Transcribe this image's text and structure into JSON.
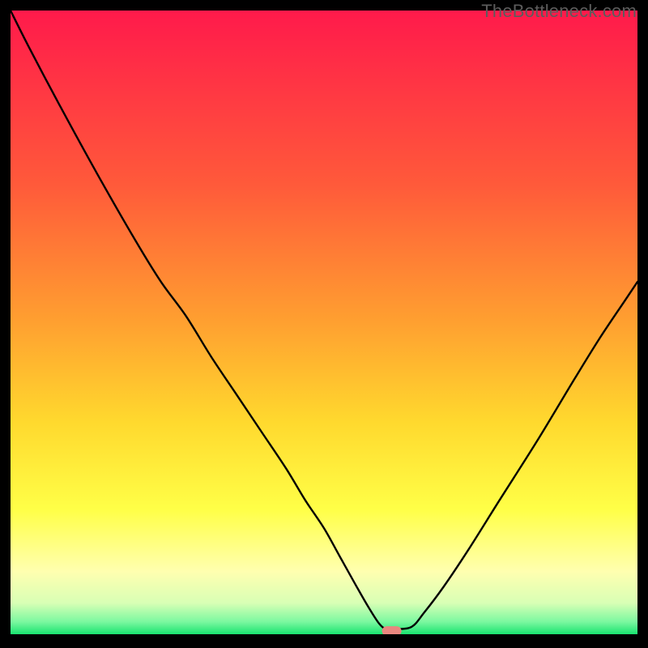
{
  "watermark": "TheBottleneck.com",
  "chart_data": {
    "type": "line",
    "title": "",
    "xlabel": "",
    "ylabel": "",
    "xlim": [
      0,
      100
    ],
    "ylim": [
      0,
      100
    ],
    "grid": false,
    "legend": false,
    "background_gradient_stops": [
      {
        "pct": 0,
        "color": "#ff1a4b"
      },
      {
        "pct": 28,
        "color": "#ff5a3a"
      },
      {
        "pct": 50,
        "color": "#ffa030"
      },
      {
        "pct": 66,
        "color": "#ffd92e"
      },
      {
        "pct": 80,
        "color": "#ffff47"
      },
      {
        "pct": 90,
        "color": "#ffffb0"
      },
      {
        "pct": 95,
        "color": "#d8ffb5"
      },
      {
        "pct": 98,
        "color": "#7bf8a0"
      },
      {
        "pct": 100,
        "color": "#19e36f"
      }
    ],
    "series": [
      {
        "name": "bottleneck-curve",
        "x": [
          0.0,
          3.0,
          8.0,
          14.0,
          20.0,
          24.0,
          28.0,
          32.0,
          36.0,
          40.0,
          44.0,
          47.0,
          50.0,
          52.5,
          55.0,
          57.0,
          58.8,
          60.0,
          61.5,
          64.0,
          66.0,
          69.0,
          73.0,
          78.0,
          84.0,
          90.0,
          94.0,
          98.0,
          100.0
        ],
        "y": [
          100.0,
          94.0,
          84.5,
          73.5,
          63.0,
          56.5,
          51.0,
          44.5,
          38.5,
          32.5,
          26.5,
          21.5,
          17.0,
          12.5,
          8.0,
          4.5,
          1.7,
          0.8,
          0.8,
          1.2,
          3.5,
          7.5,
          13.5,
          21.5,
          31.0,
          41.0,
          47.5,
          53.5,
          56.5
        ]
      }
    ],
    "marker": {
      "name": "minimum-marker",
      "x": 60.8,
      "y": 0.5,
      "color": "#e9877f"
    }
  }
}
